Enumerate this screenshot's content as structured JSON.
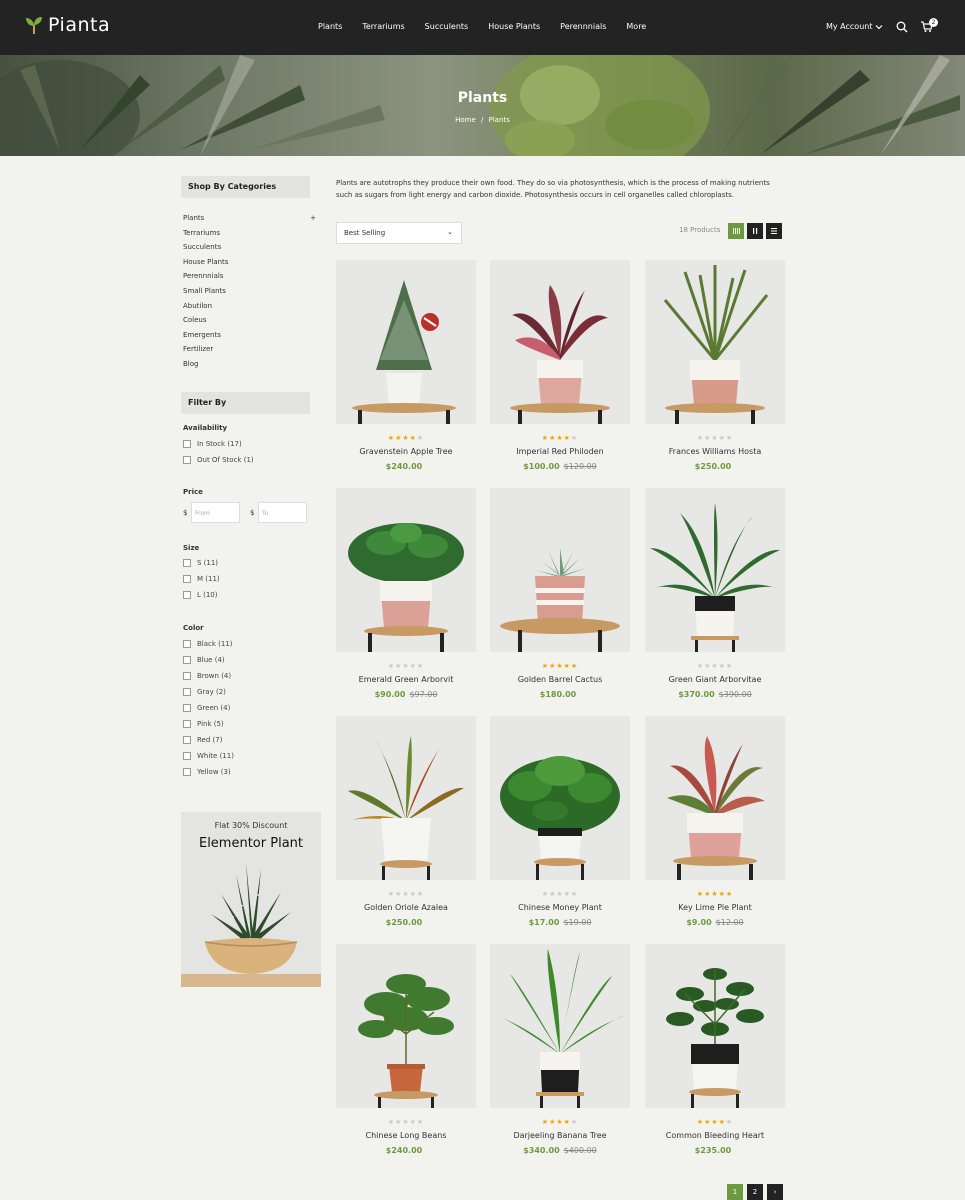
{
  "brand": {
    "name": "Pianta",
    "accent": "#6e9a3f",
    "header_bg": "#232323"
  },
  "nav": {
    "items": [
      "Plants",
      "Terrariums",
      "Succulents",
      "House Plants",
      "Perennnials",
      "More"
    ]
  },
  "header": {
    "account": "My Account",
    "cart_count": "2",
    "search_icon": "search-icon",
    "cart_icon": "cart-icon"
  },
  "banner": {
    "title": "Plants",
    "breadcrumb_home": "Home",
    "breadcrumb_sep": "/",
    "breadcrumb_current": "Plants"
  },
  "sidebar": {
    "categories_title": "Shop By Categories",
    "categories": [
      "Plants",
      "Terrariums",
      "Succulents",
      "House Plants",
      "Perennnials",
      "Small Plants",
      "Abutilon",
      "Coleus",
      "Emergents",
      "Fertilizer",
      "Blog"
    ],
    "expand_symbol": "+",
    "filter_title": "Filter By",
    "availability_label": "Availability",
    "availability": [
      "In Stock (17)",
      "Out Of Stock (1)"
    ],
    "price_label": "Price",
    "currency": "$",
    "price_from_placeholder": "From",
    "price_to_placeholder": "To",
    "size_label": "Size",
    "sizes": [
      "S (11)",
      "M (11)",
      "L (10)"
    ],
    "color_label": "Color",
    "colors": [
      "Black (11)",
      "Blue (4)",
      "Brown (4)",
      "Gray (2)",
      "Green (4)",
      "Pink (5)",
      "Red (7)",
      "White (11)",
      "Yellow (3)"
    ],
    "promo_line1": "Flat 30% Discount",
    "promo_line2": "Elementor Plant"
  },
  "main": {
    "description": "Plants are autotrophs they produce their own food. They do so via photosynthesis, which is the process of making nutrients such as sugars from light energy and carbon dioxide. Photosynthesis occurs in cell organelles called chloroplasts.",
    "sort_value": "Best Selling",
    "product_count": "18 Products",
    "view_icons": [
      "grid-4-icon",
      "grid-2-icon",
      "list-icon"
    ]
  },
  "products": [
    {
      "name": "Gravenstein Apple Tree",
      "price": "$240.00",
      "old": "",
      "rating": 4
    },
    {
      "name": "Imperial Red Philoden",
      "price": "$100.00",
      "old": "$120.00",
      "rating": 4
    },
    {
      "name": "Frances Williams Hosta",
      "price": "$250.00",
      "old": "",
      "rating": 0
    },
    {
      "name": "Emerald Green Arborvit",
      "price": "$90.00",
      "old": "$97.00",
      "rating": 0
    },
    {
      "name": "Golden Barrel Cactus",
      "price": "$180.00",
      "old": "",
      "rating": 5
    },
    {
      "name": "Green Giant Arborvitae",
      "price": "$370.00",
      "old": "$390.00",
      "rating": 0
    },
    {
      "name": "Golden Oriole Azalea",
      "price": "$250.00",
      "old": "",
      "rating": 0
    },
    {
      "name": "Chinese Money Plant",
      "price": "$17.00",
      "old": "$19.00",
      "rating": 0
    },
    {
      "name": "Key Lime Pie Plant",
      "price": "$9.00",
      "old": "$12.00",
      "rating": 5
    },
    {
      "name": "Chinese Long Beans",
      "price": "$240.00",
      "old": "",
      "rating": 0
    },
    {
      "name": "Darjeeling Banana Tree",
      "price": "$340.00",
      "old": "$400.00",
      "rating": 4
    },
    {
      "name": "Common Bleeding Heart",
      "price": "$235.00",
      "old": "",
      "rating": 4
    }
  ],
  "pagination": {
    "pages": [
      "1",
      "2"
    ],
    "next": "›",
    "current": "1"
  }
}
